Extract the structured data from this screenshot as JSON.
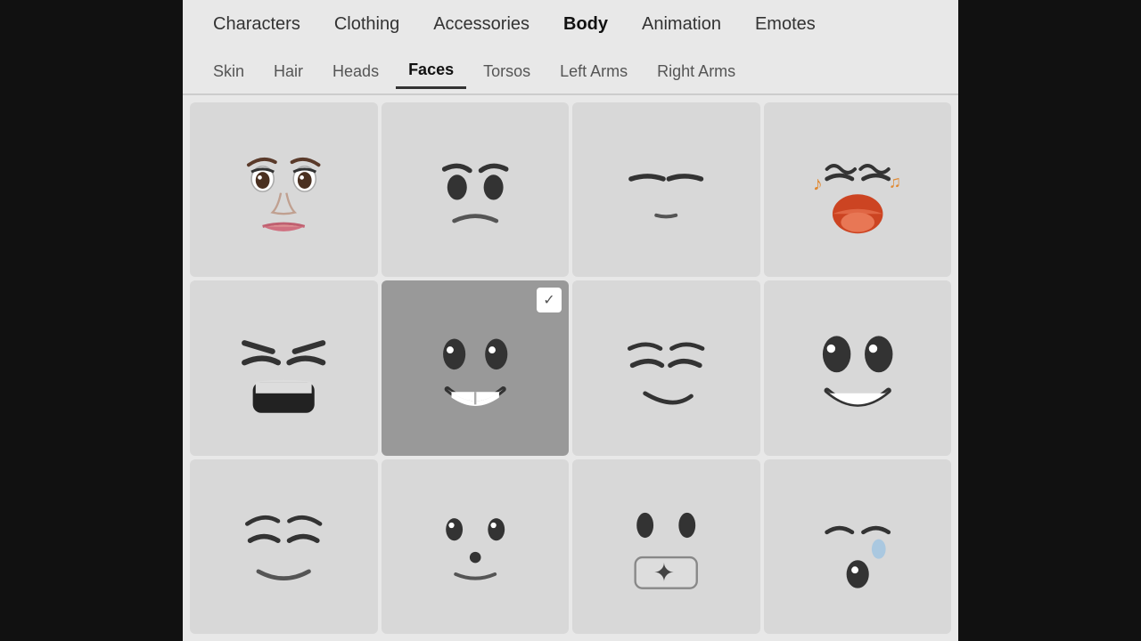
{
  "topNav": {
    "items": [
      {
        "id": "characters",
        "label": "Characters",
        "active": false
      },
      {
        "id": "clothing",
        "label": "Clothing",
        "active": false
      },
      {
        "id": "accessories",
        "label": "Accessories",
        "active": false
      },
      {
        "id": "body",
        "label": "Body",
        "active": true
      },
      {
        "id": "animation",
        "label": "Animation",
        "active": false
      },
      {
        "id": "emotes",
        "label": "Emotes",
        "active": false
      }
    ]
  },
  "subNav": {
    "items": [
      {
        "id": "skin",
        "label": "Skin",
        "active": false
      },
      {
        "id": "hair",
        "label": "Hair",
        "active": false
      },
      {
        "id": "heads",
        "label": "Heads",
        "active": false
      },
      {
        "id": "faces",
        "label": "Faces",
        "active": true
      },
      {
        "id": "torsos",
        "label": "Torsos",
        "active": false
      },
      {
        "id": "left-arms",
        "label": "Left Arms",
        "active": false
      },
      {
        "id": "right-arms",
        "label": "Right Arms",
        "active": false
      }
    ]
  },
  "faces": [
    {
      "id": 1,
      "name": "realistic-face",
      "selected": false
    },
    {
      "id": 2,
      "name": "sad-face",
      "selected": false
    },
    {
      "id": 3,
      "name": "stern-face",
      "selected": false
    },
    {
      "id": 4,
      "name": "music-face",
      "selected": false
    },
    {
      "id": 5,
      "name": "angry-laugh-face",
      "selected": false
    },
    {
      "id": 6,
      "name": "happy-default-face",
      "selected": true
    },
    {
      "id": 7,
      "name": "smirk-face",
      "selected": false
    },
    {
      "id": 8,
      "name": "smile-eyes-face",
      "selected": false
    },
    {
      "id": 9,
      "name": "smug-face",
      "selected": false
    },
    {
      "id": 10,
      "name": "dot-nose-face",
      "selected": false
    },
    {
      "id": 11,
      "name": "star-mouth-face",
      "selected": false
    },
    {
      "id": 12,
      "name": "sleepy-face",
      "selected": false
    }
  ],
  "colors": {
    "bg": "#e8e8e8",
    "card": "#d8d8d8",
    "selected": "#999999",
    "activeUnderline": "#333333"
  }
}
